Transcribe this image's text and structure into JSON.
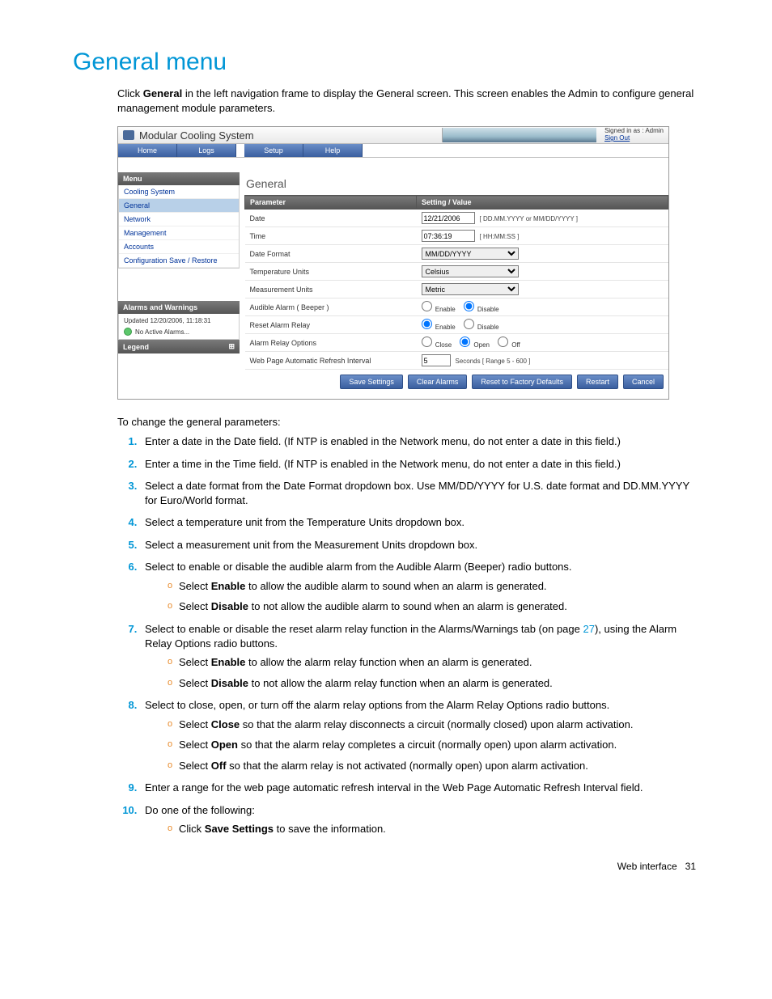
{
  "heading": "General menu",
  "intro_parts": {
    "pre": "Click ",
    "bold": "General",
    "post": " in the left navigation frame to display the General screen. This screen enables the Admin to configure general management module parameters."
  },
  "screenshot": {
    "app_title": "Modular Cooling System",
    "signed_in": "Signed in as : Admin",
    "sign_out": "Sign Out",
    "tabs": [
      "Home",
      "Logs",
      "Setup",
      "Help"
    ],
    "menu_header": "Menu",
    "menu_items": [
      "Cooling System",
      "General",
      "Network",
      "Management",
      "Accounts",
      "Configuration Save / Restore"
    ],
    "selected_menu_index": 1,
    "alarms_header": "Alarms and Warnings",
    "alarms_updated": "Updated 12/20/2006, 11:18:31",
    "alarms_none": "No Active Alarms...",
    "legend_header": "Legend",
    "section_title": "General",
    "col_param": "Parameter",
    "col_value": "Setting / Value",
    "rows": {
      "date": {
        "label": "Date",
        "value": "12/21/2006",
        "hint": "[ DD.MM.YYYY or MM/DD/YYYY ]"
      },
      "time": {
        "label": "Time",
        "value": "07:36:19",
        "hint": "[ HH:MM:SS ]"
      },
      "dateformat": {
        "label": "Date Format",
        "value": "MM/DD/YYYY"
      },
      "tempunits": {
        "label": "Temperature Units",
        "value": "Celsius"
      },
      "measunits": {
        "label": "Measurement Units",
        "value": "Metric"
      },
      "beeper": {
        "label": "Audible Alarm ( Beeper )",
        "opt_enable": "Enable",
        "opt_disable": "Disable"
      },
      "resetrelay": {
        "label": "Reset Alarm Relay",
        "opt_enable": "Enable",
        "opt_disable": "Disable"
      },
      "relayopt": {
        "label": "Alarm Relay Options",
        "opt_close": "Close",
        "opt_open": "Open",
        "opt_off": "Off"
      },
      "refresh": {
        "label": "Web Page Automatic Refresh Interval",
        "value": "5",
        "hint": "Seconds  [ Range 5 - 600 ]"
      }
    },
    "buttons": {
      "save": "Save Settings",
      "clear": "Clear Alarms",
      "reset": "Reset to Factory Defaults",
      "restart": "Restart",
      "cancel": "Cancel"
    }
  },
  "afterss": "To change the general parameters:",
  "steps": {
    "s1": "Enter a date in the Date field. (If NTP is enabled in the Network menu, do not enter a date in this field.)",
    "s2": "Enter a time in the Time field. (If NTP is enabled in the Network menu, do not enter a date in this field.)",
    "s3": "Select a date format from the Date Format dropdown box. Use MM/DD/YYYY for U.S. date format and DD.MM.YYYY for Euro/World format.",
    "s4": "Select a temperature unit from the Temperature Units dropdown box.",
    "s5": "Select a measurement unit from the Measurement Units dropdown box.",
    "s6": "Select to enable or disable the audible alarm from the Audible Alarm (Beeper) radio buttons.",
    "s6a_pre": "Select ",
    "s6a_b": "Enable",
    "s6a_post": " to allow the audible alarm to sound when an alarm is generated.",
    "s6b_pre": "Select ",
    "s6b_b": "Disable",
    "s6b_post": " to not allow the audible alarm to sound when an alarm is generated.",
    "s7_pre": "Select to enable or disable the reset alarm relay function in the Alarms/Warnings tab (on page ",
    "s7_link": "27",
    "s7_post": "), using the Alarm Relay Options radio buttons.",
    "s7a_pre": "Select ",
    "s7a_b": "Enable",
    "s7a_post": " to allow the alarm relay function when an alarm is generated.",
    "s7b_pre": "Select ",
    "s7b_b": "Disable",
    "s7b_post": " to not allow the alarm relay function when an alarm is generated.",
    "s8": "Select to close, open, or turn off the alarm relay options from the Alarm Relay Options radio buttons.",
    "s8a_pre": "Select ",
    "s8a_b": "Close",
    "s8a_post": " so that the alarm relay disconnects a circuit (normally closed) upon alarm activation.",
    "s8b_pre": "Select ",
    "s8b_b": "Open",
    "s8b_post": " so that the alarm relay completes a circuit (normally open) upon alarm activation.",
    "s8c_pre": "Select ",
    "s8c_b": "Off",
    "s8c_post": " so that the alarm relay is not activated (normally open) upon alarm activation.",
    "s9": "Enter a range for the web page automatic refresh interval in the Web Page Automatic Refresh Interval field.",
    "s10": "Do one of the following:",
    "s10a_pre": "Click ",
    "s10a_b": "Save Settings",
    "s10a_post": " to save the information."
  },
  "footer": {
    "label": "Web interface",
    "page": "31"
  }
}
